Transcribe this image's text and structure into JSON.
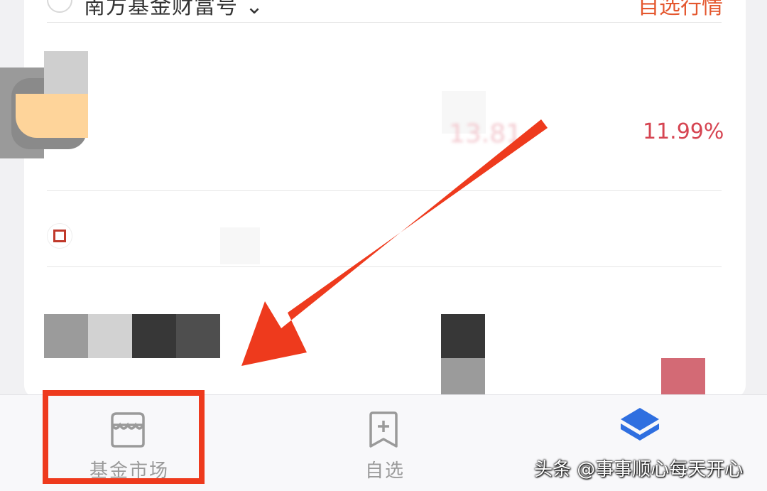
{
  "header": {
    "title": "南方基金财富号",
    "title_suffix": "⌄",
    "link": "自选行情"
  },
  "fund_row_1": {
    "value": "13.81",
    "percent": "11.99%"
  },
  "tabbar": {
    "tabs": [
      {
        "label": "基金市场",
        "icon": "storefront-icon",
        "selected": false
      },
      {
        "label": "自选",
        "icon": "bookmark-plus-icon",
        "selected": false
      },
      {
        "label": "",
        "icon": "layers-icon",
        "selected": true
      }
    ]
  },
  "annotation": {
    "arrow_color": "#ee3a1d",
    "box_color": "#ee3a1d"
  },
  "watermark": "头条 @事事顺心每天开心",
  "colors": {
    "accent": "#e4572e",
    "up_red": "#d64552",
    "tab_active": "#2f6fe0",
    "tab_inactive": "#9a9a9a"
  }
}
